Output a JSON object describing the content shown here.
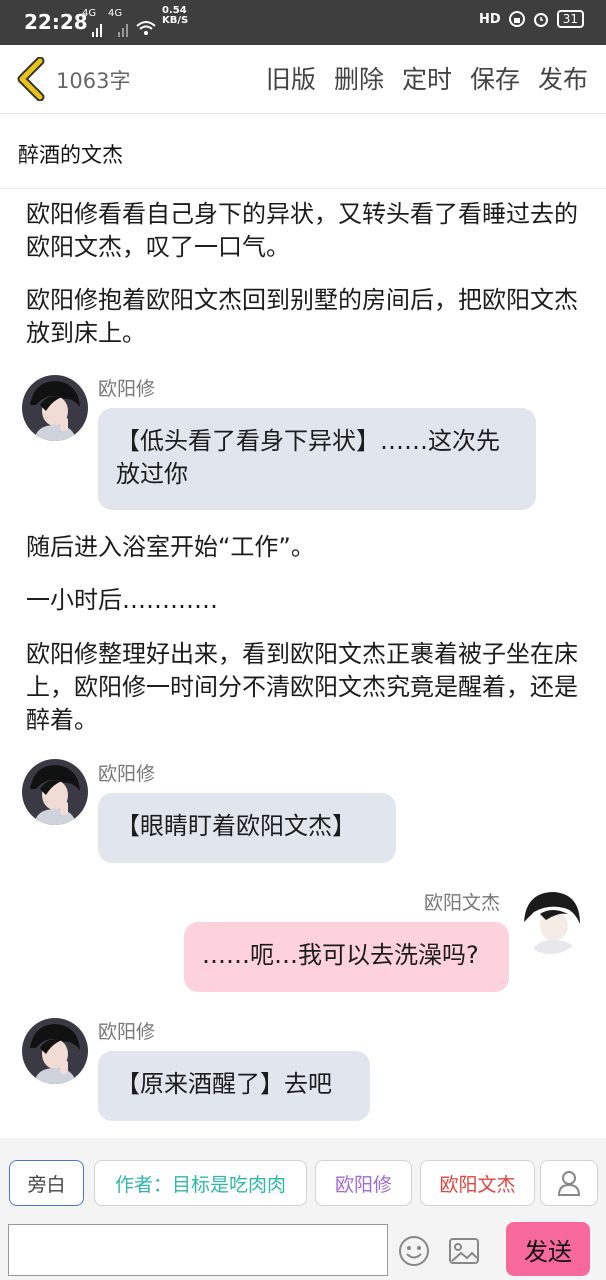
{
  "status_bar": {
    "time": "22:28",
    "net1": "4G",
    "net2": "4G",
    "speed_value": "0.54",
    "speed_unit": "KB/S",
    "hd": "HD",
    "battery": "31"
  },
  "toolbar": {
    "word_count": "1063字",
    "old_version": "旧版",
    "delete": "删除",
    "schedule": "定时",
    "save": "保存",
    "publish": "发布"
  },
  "document": {
    "title": "醉酒的文杰"
  },
  "messages": [
    {
      "type": "narration",
      "text": "欧阳修看看自己身下的异状，又转头看了看睡过去的欧阳文杰，叹了一口气。"
    },
    {
      "type": "narration",
      "text": "欧阳修抱着欧阳文杰回到别墅的房间后，把欧阳文杰放到床上。"
    },
    {
      "type": "chat",
      "side": "left",
      "speaker": "欧阳修",
      "text": "【低头看了看身下异状】……这次先放过你"
    },
    {
      "type": "narration",
      "text": "随后进入浴室开始“工作”。"
    },
    {
      "type": "narration",
      "text": "一小时后…………"
    },
    {
      "type": "narration",
      "text": "欧阳修整理好出来，看到欧阳文杰正裹着被子坐在床上，欧阳修一时间分不清欧阳文杰究竟是醒着，还是醉着。"
    },
    {
      "type": "chat",
      "side": "left",
      "speaker": "欧阳修",
      "text": "【眼睛盯着欧阳文杰】"
    },
    {
      "type": "chat",
      "side": "right",
      "speaker": "欧阳文杰",
      "text": "……呃…我可以去洗澡吗?"
    },
    {
      "type": "chat",
      "side": "left",
      "speaker": "欧阳修",
      "text": "【原来酒醒了】去吧"
    }
  ],
  "role_bar": {
    "narration": "旁白",
    "author": "作者：目标是吃肉肉",
    "role1": "欧阳修",
    "role2": "欧阳文杰",
    "colors": {
      "narration": "#4a76c9",
      "author": "#2fb7a8",
      "role1": "#a06ad8",
      "role2": "#e0443c",
      "send_button": "#f7689b",
      "back_arrow": "#e9c21a"
    }
  },
  "input_bar": {
    "placeholder": "",
    "send": "发送",
    "icons": [
      "emoji-icon",
      "image-icon",
      "user-icon"
    ]
  }
}
